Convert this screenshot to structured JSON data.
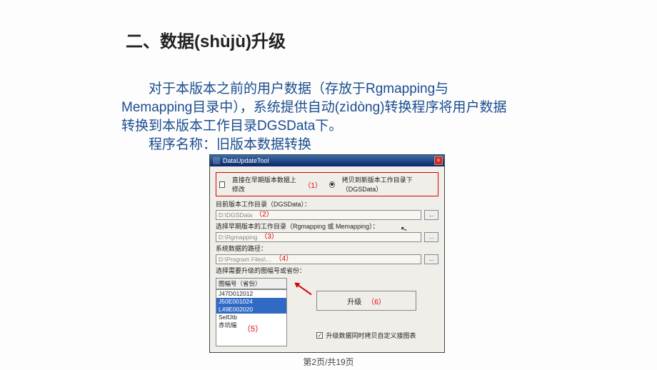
{
  "heading": "二、数据(shùjù)升级",
  "para1": "对于本版本之前的用户数据（存放于Rgmapping与Memapping目录中），系统提供自动(zìdòng)转换程序将用户数据转换到本版本工作目录DGSData下。",
  "para2": "程序名称：旧版本数据转换",
  "shot": {
    "title": "DataUpdateTool",
    "opt1": "直接在早期版本数据上修改",
    "opt2": "拷贝到新版本工作目录下（DGSData）",
    "mark1": "（1）",
    "label_current": "目前版本工作目录（DGSData）：",
    "val_current": "D:\\DGSData",
    "mark2": "（2）",
    "label_old": "选择早期版本的工作目录（Rgmapping 或 Memapping）：",
    "val_old": "D:\\Rgmapping",
    "mark3": "（3）",
    "label_sys": "系统数据的路径：",
    "val_sys": "D:\\Program Files\\…",
    "mark4": "（4）",
    "label_list": "选择需要升级的图幅号或省份：",
    "list_header": "图幅号（省份）",
    "items": [
      "J47D012012",
      "J50E001024",
      "L49E002020",
      "SelfJtb",
      "赤坑幅"
    ],
    "mark5": "（5）",
    "upgrade": "升级",
    "mark6": "（6）",
    "chk": "升级数据同时拷贝自定义接图表",
    "browse": "..."
  },
  "pagenum": "第2页/共19页"
}
